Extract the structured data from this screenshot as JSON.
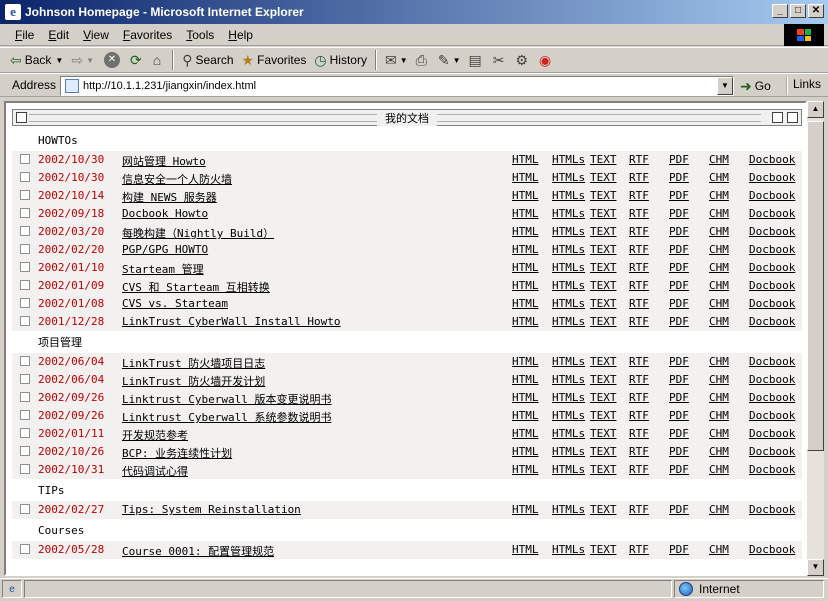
{
  "window": {
    "title": "Johnson Homepage - Microsoft Internet Explorer",
    "icon": "ie-icon",
    "controls": {
      "minimize": "_",
      "maximize": "□",
      "close": "✕"
    }
  },
  "menubar": [
    {
      "hot": "F",
      "rest": "ile"
    },
    {
      "hot": "E",
      "rest": "dit"
    },
    {
      "hot": "V",
      "rest": "iew"
    },
    {
      "hot": "F",
      "rest": "avorites"
    },
    {
      "hot": "T",
      "rest": "ools"
    },
    {
      "hot": "H",
      "rest": "elp"
    }
  ],
  "toolbar": {
    "back": "Back",
    "search": "Search",
    "favorites": "Favorites",
    "history": "History"
  },
  "address": {
    "label": "Address",
    "url": "http://10.1.1.231/jiangxin/index.html",
    "go": "Go",
    "links": "Links"
  },
  "panel": {
    "title": "我的文档"
  },
  "formats": [
    "HTML",
    "HTMLs",
    "TEXT",
    "RTF",
    "PDF",
    "CHM",
    "Docbook"
  ],
  "sections": [
    {
      "name": "HOWTOs",
      "rows": [
        {
          "date": "2002/10/30",
          "title": "网站管理 Howto"
        },
        {
          "date": "2002/10/30",
          "title": "信息安全一个人防火墙"
        },
        {
          "date": "2002/10/14",
          "title": "构建 NEWS 服务器"
        },
        {
          "date": "2002/09/18",
          "title": "Docbook Howto"
        },
        {
          "date": "2002/03/20",
          "title": "每晚构建（Nightly Build）"
        },
        {
          "date": "2002/02/20",
          "title": "PGP/GPG HOWTO"
        },
        {
          "date": "2002/01/10",
          "title": "Starteam 管理"
        },
        {
          "date": "2002/01/09",
          "title": "CVS 和 Starteam 互相转换"
        },
        {
          "date": "2002/01/08",
          "title": "CVS vs. Starteam"
        },
        {
          "date": "2001/12/28",
          "title": "LinkTrust CyberWall Install Howto"
        }
      ]
    },
    {
      "name": "项目管理",
      "rows": [
        {
          "date": "2002/06/04",
          "title": "LinkTrust 防火墙项目日志"
        },
        {
          "date": "2002/06/04",
          "title": "LinkTrust 防火墙开发计划"
        },
        {
          "date": "2002/09/26",
          "title": "Linktrust Cyberwall 版本变更说明书"
        },
        {
          "date": "2002/09/26",
          "title": "Linktrust Cyberwall 系统参数说明书"
        },
        {
          "date": "2002/01/11",
          "title": "开发规范参考"
        },
        {
          "date": "2002/10/26",
          "title": "BCP: 业务连续性计划"
        },
        {
          "date": "2002/10/31",
          "title": "代码调试心得"
        }
      ]
    },
    {
      "name": "TIPs",
      "rows": [
        {
          "date": "2002/02/27",
          "title": "Tips: System Reinstallation"
        }
      ]
    },
    {
      "name": "Courses",
      "rows": [
        {
          "date": "2002/05/28",
          "title": "Course 0001: 配置管理规范"
        }
      ]
    }
  ],
  "statusbar": {
    "zone": "Internet"
  }
}
